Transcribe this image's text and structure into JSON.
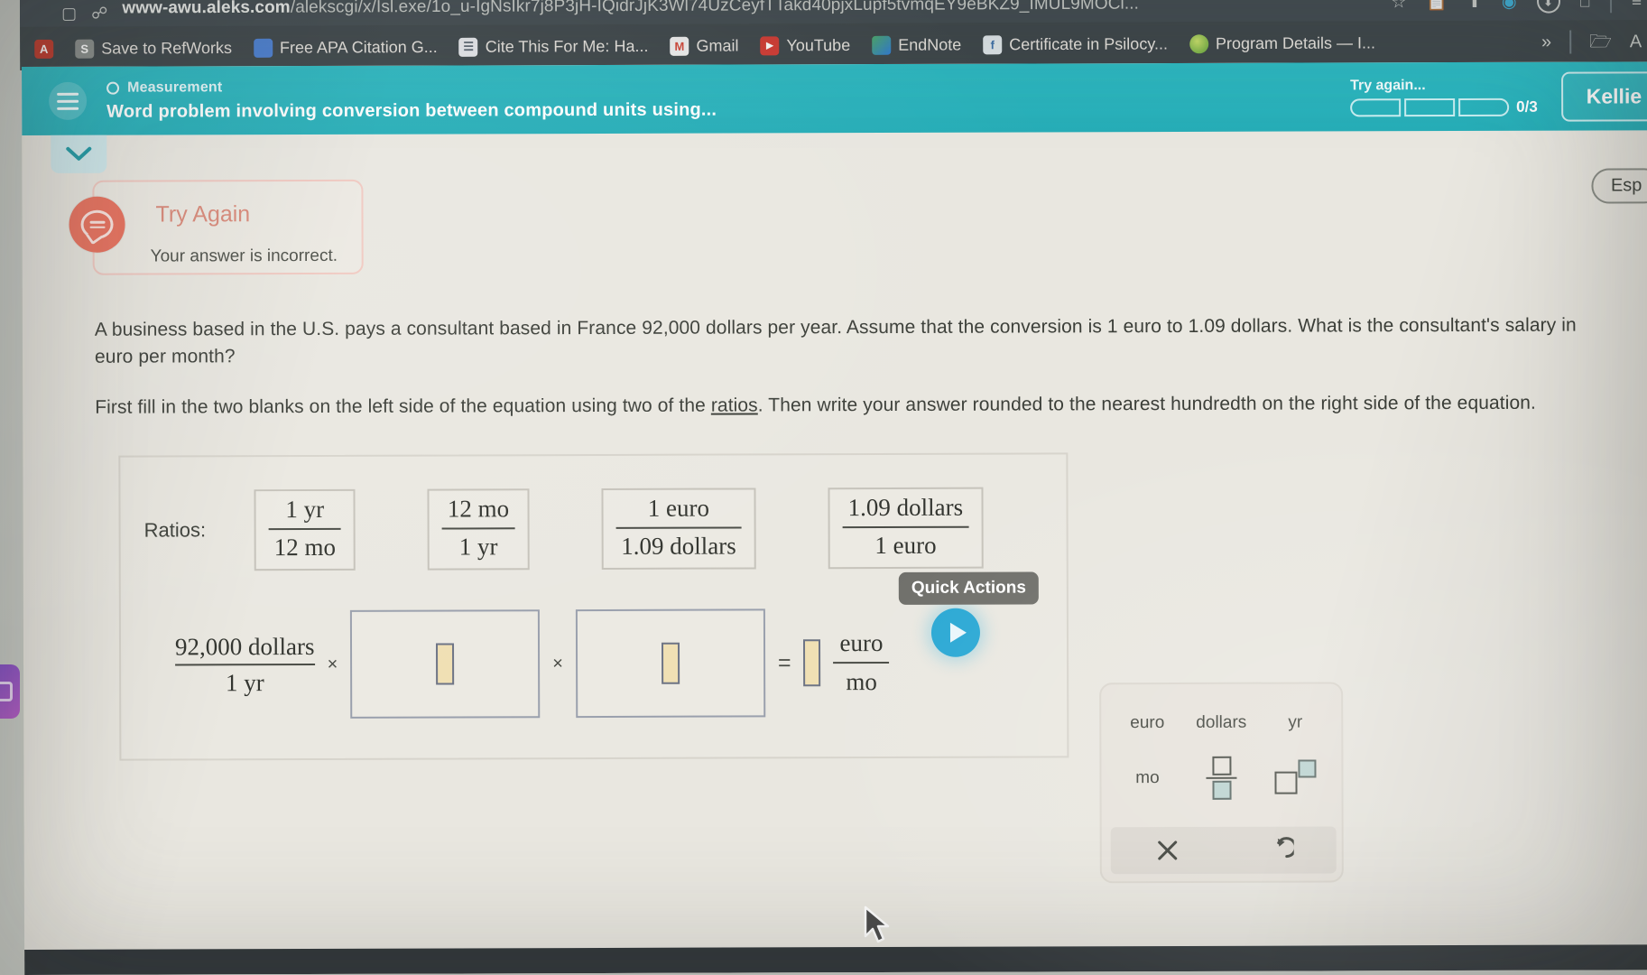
{
  "browser": {
    "url_prefix": "www-awu.aleks.com",
    "url_path": "/alekscgi/x/Isl.exe/1o_u-IgNsIkr7j8P3jH-IQidrJjK3Wl74UzCeyfTTakd40pjxLupf5tvmqEY9eBKZ9_IMUL9MOCi...",
    "bookmarks": [
      {
        "label": "Save to RefWorks",
        "icon": "refworks-icon",
        "color": "#8a8f8c",
        "glyph": "S"
      },
      {
        "label": "Free APA Citation G...",
        "icon": "bookmark-icon",
        "color": "#4a7fd4",
        "glyph": ""
      },
      {
        "label": "Cite This For Me: Ha...",
        "icon": "book-icon",
        "color": "#e8eaee",
        "glyph": ""
      },
      {
        "label": "Gmail",
        "icon": "gmail-icon",
        "color": "#efefef",
        "glyph": "M"
      },
      {
        "label": "YouTube",
        "icon": "youtube-icon",
        "color": "#d33a32",
        "glyph": "▶"
      },
      {
        "label": "EndNote",
        "icon": "endnote-icon",
        "color": "#4aa86a",
        "glyph": ""
      },
      {
        "label": "Certificate in Psilocy...",
        "icon": "certificate-icon",
        "color": "#dfe6ea",
        "glyph": "f"
      },
      {
        "label": "Program Details — I...",
        "icon": "program-icon",
        "color": "#7ab648",
        "glyph": ""
      }
    ],
    "overflow_label": "»",
    "toolbar_icons": [
      "star-icon",
      "copy-icon",
      "upload-icon",
      "play-circle-icon",
      "download-icon",
      "extensions-icon",
      "list-icon"
    ]
  },
  "header": {
    "menu_icon": "hamburger-icon",
    "category": "Measurement",
    "title": "Word problem involving conversion between compound units using...",
    "progress_label": "Try again...",
    "progress_count": "0/3",
    "progress_segments": 3,
    "progress_filled": 0,
    "user_button": "Kellie",
    "language_toggle": "Esp",
    "collapse_icon": "chevron-down-icon",
    "accent_color": "#2bb5bf"
  },
  "feedback": {
    "icon": "speech-bubble-icon",
    "title": "Try Again",
    "message": "Your answer is incorrect.",
    "accent_color": "#e8705c"
  },
  "problem": {
    "paragraph_1": "A business based in the U.S. pays a consultant based in France 92,000 dollars per year. Assume that the conversion is 1 euro to 1.09 dollars. What is the consultant's salary in euro per month?",
    "paragraph_2_before": "First fill in the two blanks on the left side of the equation using two of the ",
    "paragraph_2_link": "ratios",
    "paragraph_2_after": ". Then write your answer rounded to the nearest hundredth on the right side of the equation."
  },
  "work_area": {
    "ratios_label": "Ratios:",
    "ratios": [
      {
        "numerator": "1 yr",
        "denominator": "12 mo"
      },
      {
        "numerator": "12 mo",
        "denominator": "1 yr"
      },
      {
        "numerator": "1 euro",
        "denominator": "1.09 dollars"
      },
      {
        "numerator": "1.09 dollars",
        "denominator": "1 euro"
      }
    ],
    "equation": {
      "given_numerator": "92,000 dollars",
      "given_denominator": "1 yr",
      "multiply_symbol": "×",
      "equals_symbol": "=",
      "blank_1_value": "",
      "blank_2_value": "",
      "answer_value": "",
      "answer_unit_numerator": "euro",
      "answer_unit_denominator": "mo"
    }
  },
  "quick_actions": {
    "tooltip": "Quick Actions",
    "icon": "play-circle-icon"
  },
  "keypad": {
    "keys": [
      {
        "label": "euro",
        "name": "keypad-key-euro",
        "type": "text"
      },
      {
        "label": "dollars",
        "name": "keypad-key-dollars",
        "type": "text"
      },
      {
        "label": "yr",
        "name": "keypad-key-yr",
        "type": "text"
      },
      {
        "label": "mo",
        "name": "keypad-key-mo",
        "type": "text"
      },
      {
        "label": "",
        "name": "keypad-key-fraction",
        "type": "fraction"
      },
      {
        "label": "",
        "name": "keypad-key-exponent",
        "type": "exponent"
      }
    ],
    "clear_icon": "close-icon",
    "undo_icon": "undo-icon"
  },
  "cursor": {
    "icon": "mouse-pointer-icon"
  }
}
